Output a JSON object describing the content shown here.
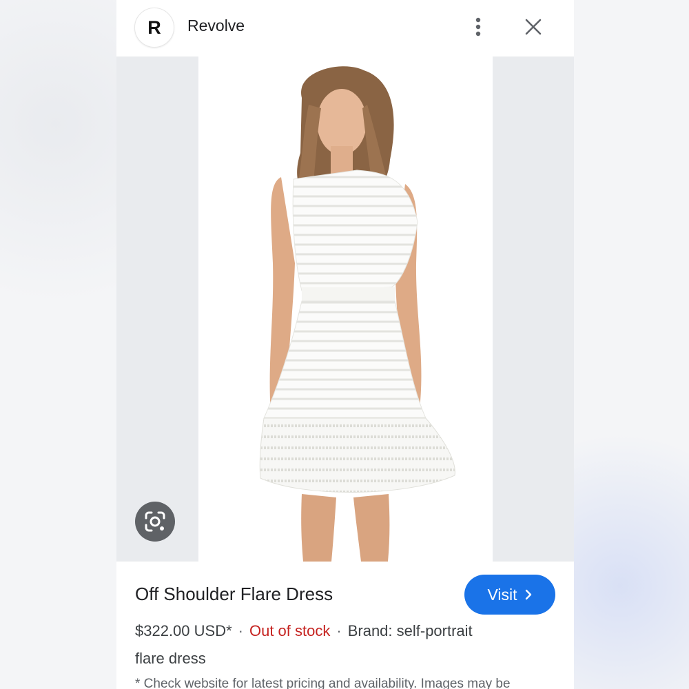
{
  "header": {
    "logo_letter": "R",
    "site_name": "Revolve",
    "more_icon": "more-vert-icon",
    "close_icon": "close-icon"
  },
  "image": {
    "subject": "product-photo",
    "lens_icon": "google-lens-icon"
  },
  "product": {
    "title": "Off Shoulder Flare Dress",
    "visit_label": "Visit",
    "price": "$322.00 USD*",
    "separator": "·",
    "stock_status": "Out of stock",
    "brand": "Brand: self-portrait",
    "description": "flare dress",
    "disclaimer": "* Check website for latest pricing and availability. Images may be"
  },
  "colors": {
    "accent": "#1a73e8",
    "out_of_stock": "#c5221f",
    "text": "#202124"
  }
}
